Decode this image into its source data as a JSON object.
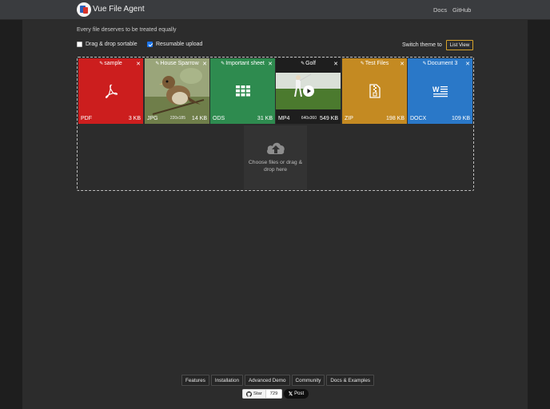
{
  "header": {
    "title": "Vue File Agent",
    "links": [
      "Docs",
      "GitHub"
    ]
  },
  "tagline": "Every file deserves to be treated equally",
  "options": {
    "sortable_label": "Drag & drop sortable",
    "sortable_checked": false,
    "resumable_label": "Resumable upload",
    "resumable_checked": true
  },
  "theme": {
    "switch_label": "Switch theme to",
    "button_label": "List View",
    "accent": "#d6a22b"
  },
  "files": [
    {
      "name": "sample",
      "ext": "PDF",
      "size": "3 KB",
      "color": "#cc1e1e",
      "icon": "pdf-icon"
    },
    {
      "name": "House Sparrow",
      "ext": "JPG",
      "size": "14 KB",
      "dims": "220x185",
      "color": "#7d8a58",
      "icon": "image-thumbnail"
    },
    {
      "name": "Important sheet",
      "ext": "ODS",
      "size": "31 KB",
      "color": "#2e8b4f",
      "icon": "spreadsheet-icon"
    },
    {
      "name": "Golf",
      "ext": "MP4",
      "size": "549 KB",
      "dims": "640x360",
      "color": "#4a6b3a",
      "icon": "video-thumbnail"
    },
    {
      "name": "Test Files",
      "ext": "ZIP",
      "size": "198 KB",
      "color": "#c48a22",
      "icon": "zip-icon"
    },
    {
      "name": "Document 3",
      "ext": "DOCX",
      "size": "109 KB",
      "color": "#2a78c8",
      "icon": "word-icon"
    }
  ],
  "picker": {
    "text": "Choose files or drag & drop here",
    "icon": "cloud-upload-icon"
  },
  "footer": {
    "links": [
      "Features",
      "Installation",
      "Advanced Demo",
      "Community",
      "Docs & Examples"
    ],
    "star_label": "Star",
    "star_count": "729",
    "post_label": "Post"
  }
}
